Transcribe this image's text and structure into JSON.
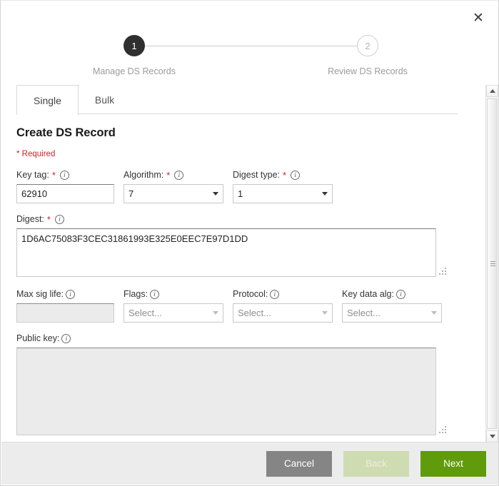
{
  "dialog": {
    "close_label": "✕"
  },
  "stepper": {
    "steps": [
      {
        "number": "1",
        "label": "Manage DS Records",
        "state": "active"
      },
      {
        "number": "2",
        "label": "Review DS Records",
        "state": "inactive"
      }
    ]
  },
  "tabs": [
    {
      "label": "Single",
      "active": true
    },
    {
      "label": "Bulk",
      "active": false
    }
  ],
  "form": {
    "title": "Create DS Record",
    "required_note": "* Required",
    "info_glyph": "i",
    "required_star": "*",
    "fields": {
      "key_tag": {
        "label": "Key tag:",
        "value": "62910",
        "required": true
      },
      "algorithm": {
        "label": "Algorithm:",
        "value": "7",
        "required": true
      },
      "digest_type": {
        "label": "Digest type:",
        "value": "1",
        "required": true
      },
      "digest": {
        "label": "Digest:",
        "value": "1D6AC75083F3CEC31861993E325E0EEC7E97D1DD",
        "required": true
      },
      "max_sig_life": {
        "label": "Max sig life:",
        "value": "",
        "required": false
      },
      "flags": {
        "label": "Flags:",
        "value": "Select...",
        "required": false
      },
      "protocol": {
        "label": "Protocol:",
        "value": "Select...",
        "required": false
      },
      "key_data_alg": {
        "label": "Key data alg:",
        "value": "Select...",
        "required": false
      },
      "public_key": {
        "label": "Public key:",
        "value": "",
        "required": false
      }
    }
  },
  "footer": {
    "cancel_label": "Cancel",
    "back_label": "Back",
    "next_label": "Next"
  },
  "colors": {
    "accent_green": "#5f9b0a",
    "required_red": "#cc2222",
    "step_active": "#2f2f2f",
    "cancel_gray": "#858585",
    "back_disabled": "#cfdcb2"
  }
}
